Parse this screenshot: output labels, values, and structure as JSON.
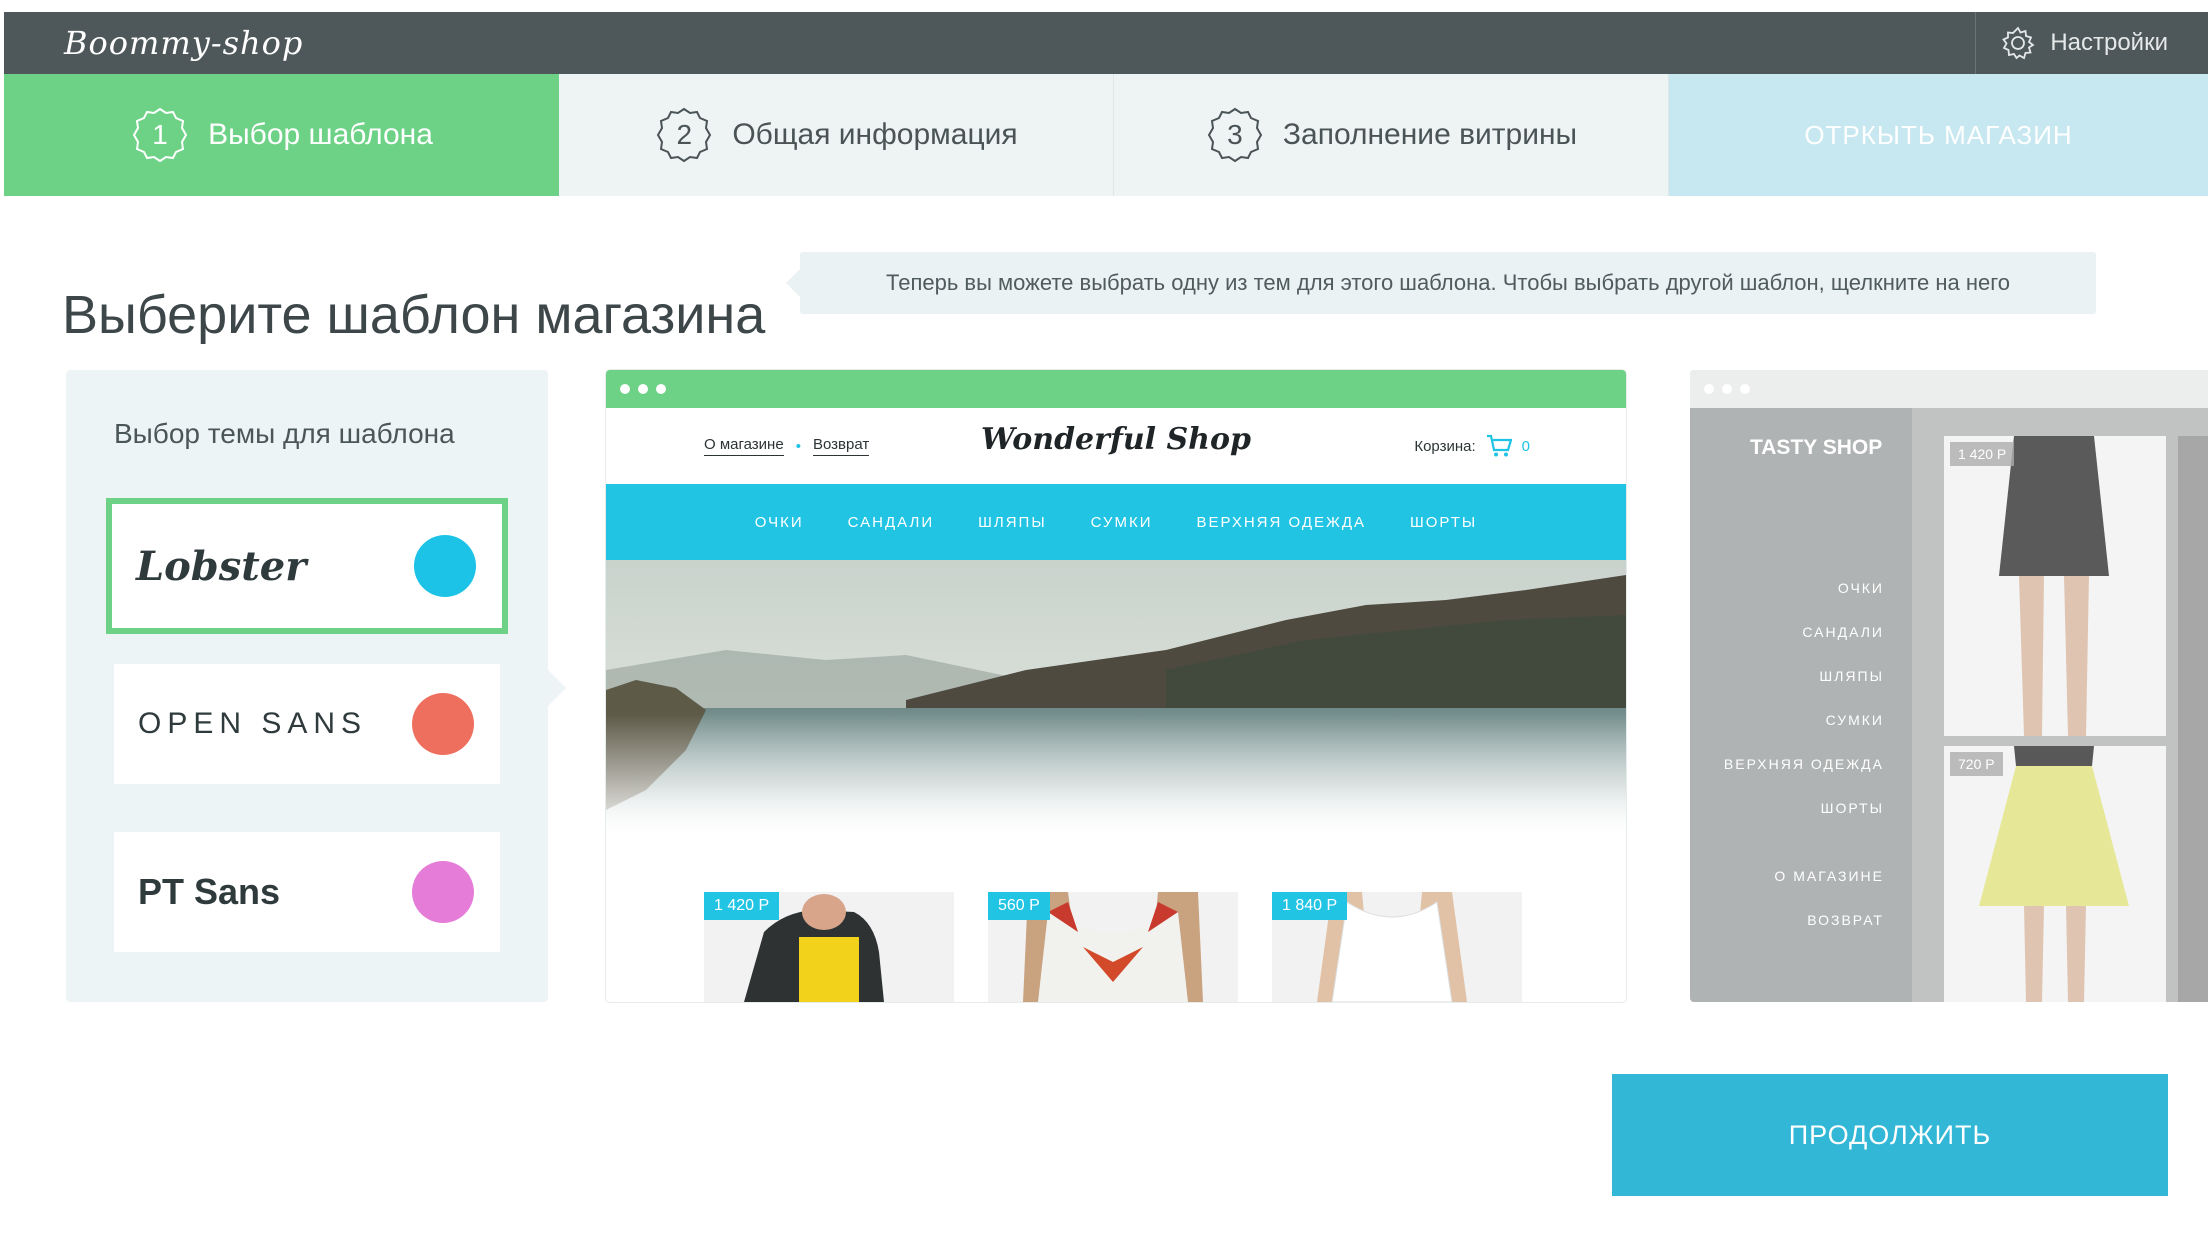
{
  "app": {
    "logo": "Boommy-shop"
  },
  "header": {
    "settings_label": "Настройки"
  },
  "steps": [
    {
      "number": "1",
      "label": "Выбор шаблона",
      "state": "active"
    },
    {
      "number": "2",
      "label": "Общая информация",
      "state": "inactive"
    },
    {
      "number": "3",
      "label": "Заполнение витрины",
      "state": "inactive"
    },
    {
      "label": "ОТРКЫТЬ МАГАЗИН",
      "state": "disabled"
    }
  ],
  "page": {
    "title": "Выберите шаблон магазина",
    "hint": "Теперь вы можете выбрать одну из тем для этого шаблона. Чтобы выбрать другой шаблон, щелкните на него"
  },
  "themes": {
    "title": "Выбор  темы для шаблона",
    "items": [
      {
        "name": "Lobster",
        "color": "#1cc3e6",
        "selected": true
      },
      {
        "name": "OPEN SANS",
        "color": "#ef6f5e",
        "selected": false
      },
      {
        "name": "PT Sans",
        "color": "#e57dd8",
        "selected": false
      }
    ]
  },
  "preview": {
    "links": [
      "О магазине",
      "Возврат"
    ],
    "shop_name": "Wonderful Shop",
    "cart_label": "Корзина:",
    "cart_count": "0",
    "nav": [
      "ОЧКИ",
      "САНДАЛИ",
      "ШЛЯПЫ",
      "СУМКИ",
      "ВЕРХНЯЯ ОДЕЖДА",
      "ШОРТЫ"
    ],
    "products": [
      {
        "price": "1 420 Р"
      },
      {
        "price": "560 Р"
      },
      {
        "price": "1 840 Р"
      }
    ],
    "accent": "#22c4e4",
    "bar_color": "#6dd285"
  },
  "preview2": {
    "shop_name": "TASTY SHOP",
    "menu": [
      "ОЧКИ",
      "САНДАЛИ",
      "ШЛЯПЫ",
      "СУМКИ",
      "ВЕРХНЯЯ ОДЕЖДА",
      "ШОРТЫ",
      "О МАГАЗИНЕ",
      "ВОЗВРАТ"
    ],
    "products": [
      {
        "price": "1 420 Р"
      },
      {
        "price": "720 Р"
      }
    ]
  },
  "actions": {
    "continue_label": "ПРОДОЛЖИТЬ"
  },
  "colors": {
    "green": "#6dd285",
    "topbar": "#4e5759",
    "cta": "#32b7d6"
  }
}
